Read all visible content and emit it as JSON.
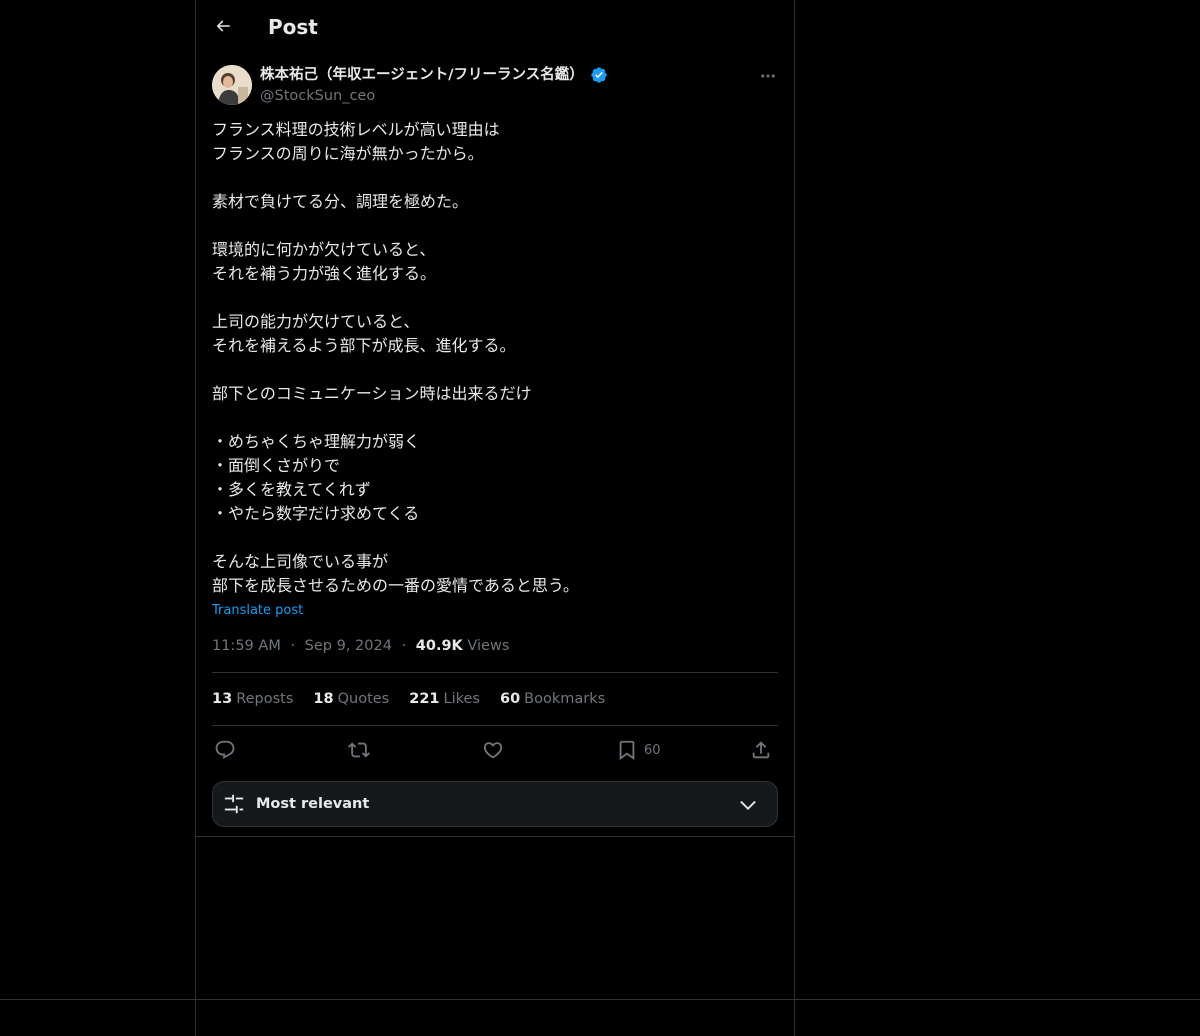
{
  "header": {
    "title": "Post"
  },
  "author": {
    "name": "株本祐己（年収エージェント/フリーランス名鑑）",
    "handle": "@StockSun_ceo",
    "verified": true
  },
  "post": {
    "lines": [
      "フランス料理の技術レベルが高い理由は",
      "フランスの周りに海が無かったから。",
      "",
      "素材で負けてる分、調理を極めた。",
      "",
      "環境的に何かが欠けていると、",
      "それを補う力が強く進化する。",
      "",
      "上司の能力が欠けていると、",
      "それを補えるよう部下が成長、進化する。",
      "",
      "部下とのコミュニケーション時は出来るだけ",
      "",
      "・めちゃくちゃ理解力が弱く",
      "・面倒くさがりで",
      "・多くを教えてくれず",
      "・やたら数字だけ求めてくる",
      "",
      "そんな上司像でいる事が",
      "部下を成長させるための一番の愛情であると思う。"
    ],
    "translate_label": "Translate post",
    "time": "11:59 AM",
    "date": "Sep 9, 2024",
    "separator": "·",
    "views_count": "40.9K",
    "views_label": "Views"
  },
  "stats": {
    "reposts_count": "13",
    "reposts_label": "Reposts",
    "quotes_count": "18",
    "quotes_label": "Quotes",
    "likes_count": "221",
    "likes_label": "Likes",
    "bookmarks_count": "60",
    "bookmarks_label": "Bookmarks"
  },
  "actions": {
    "bookmark_count": "60",
    "icons": [
      "reply-icon",
      "repost-icon",
      "like-icon",
      "bookmark-icon",
      "share-icon"
    ]
  },
  "sort": {
    "label": "Most relevant"
  },
  "colors": {
    "background": "#000000",
    "text": "#e7e9ea",
    "secondary": "#71767b",
    "accent": "#1d9bf0",
    "border": "#2f3336"
  }
}
